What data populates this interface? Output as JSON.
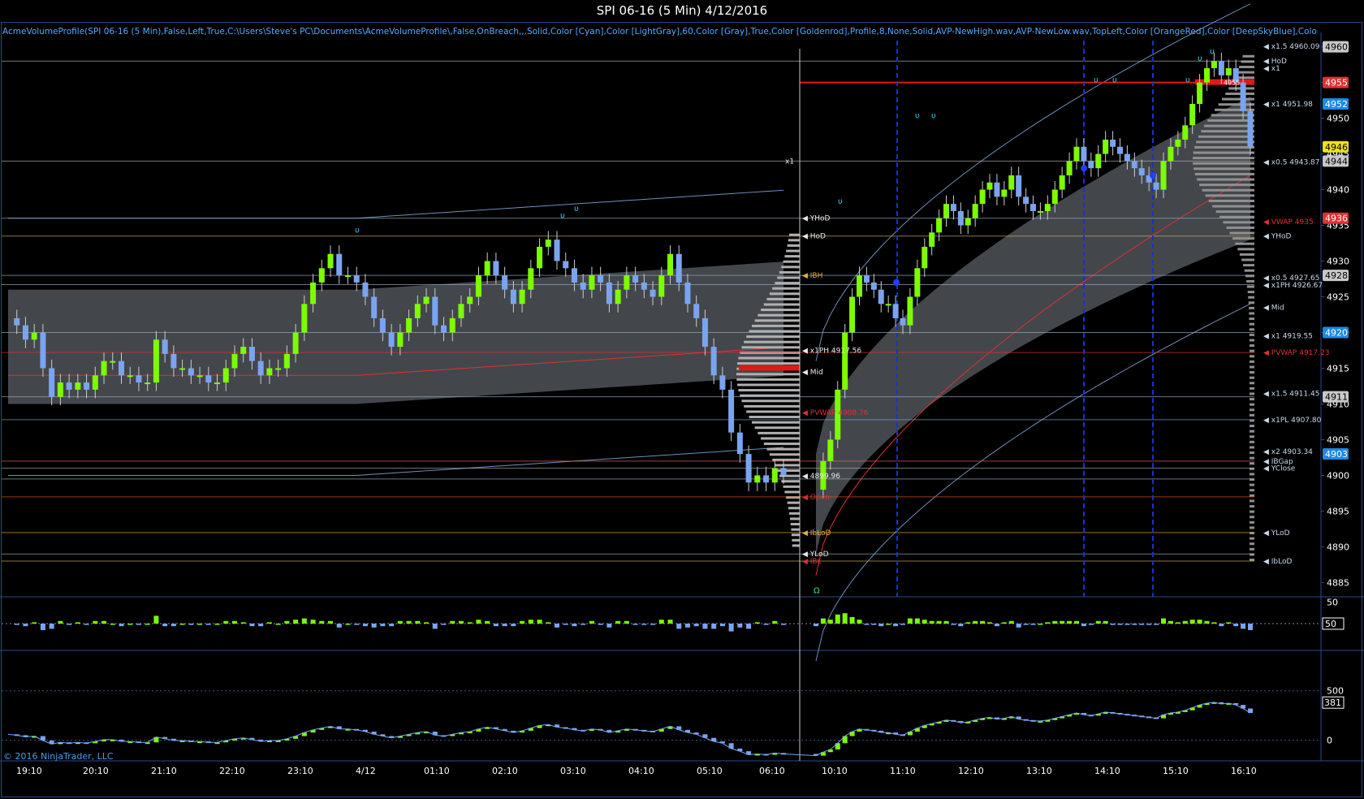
{
  "window": {
    "title": "SPI 06-16 (5 Min)  4/12/2016",
    "indicator_string": "AcmeVolumeProfile(SPI 06-16 (5 Min),False,Left,True,C:\\Users\\Steve's PC\\Documents\\AcmeVolumeProfile\\,False,OnBreach,,,Solid,Color [Cyan],Color [LightGray],60,Color [Gray],True,Color [Goldenrod],Profile,8,None,Solid,AVP-NewHigh.wav,AVP-NewLow.wav,TopLeft,Color [OrangeRed],Color [DeepSkyBlue],Color [Slat",
    "copyright": "© 2016 NinjaTrader, LLC"
  },
  "colors": {
    "up_bar": "#7cfc00",
    "down_bar": "#7ba4f0",
    "band": "#5a5f66",
    "vwap": "#e03030",
    "grid_line": "#9fb4c8",
    "axis_text": "#ffffff",
    "accent_blue": "#1e88e5"
  },
  "chart_data": [
    {
      "type": "candlestick",
      "title": "SPI 06-16 (5 Min)  4/12/2016",
      "x_ticks": [
        "19:10",
        "20:10",
        "21:10",
        "22:10",
        "23:10",
        "4/12",
        "01:10",
        "02:10",
        "03:10",
        "04:10",
        "05:10",
        "06:10",
        "10:10",
        "11:10",
        "12:10",
        "13:10",
        "14:10",
        "15:10",
        "16:10"
      ],
      "ylim": [
        4883,
        4962
      ],
      "y_ticks": [
        4885,
        4890,
        4895,
        4900,
        4905,
        4910,
        4915,
        4920,
        4925,
        4930,
        4935,
        4940,
        4945,
        4950,
        4955,
        4960
      ],
      "price_tags": [
        {
          "label": "4960",
          "color": "#c8c8c8",
          "value": 4960
        },
        {
          "label": "4955",
          "color": "#e03030",
          "value": 4955
        },
        {
          "label": "4952",
          "color": "#1e88e5",
          "value": 4952
        },
        {
          "label": "4946",
          "color": "#f0e020",
          "value": 4946
        },
        {
          "label": "4944",
          "color": "#c8c8c8",
          "value": 4944
        },
        {
          "label": "4936",
          "color": "#e03030",
          "value": 4936
        },
        {
          "label": "4928",
          "color": "#c8c8c8",
          "value": 4928
        },
        {
          "label": "4920",
          "color": "#1e88e5",
          "value": 4920
        },
        {
          "label": "4911",
          "color": "#c8c8c8",
          "value": 4911
        },
        {
          "label": "4903",
          "color": "#1e88e5",
          "value": 4903
        }
      ],
      "level_labels": [
        {
          "text": "x1.5  4960.09",
          "value": 4960.09
        },
        {
          "text": "HoD",
          "value": 4958
        },
        {
          "text": "x1",
          "value": 4957
        },
        {
          "text": "x1  4951.98",
          "value": 4951.98
        },
        {
          "text": "x0.5  4943.87",
          "value": 4943.87
        },
        {
          "text": "VWAP  4935",
          "value": 4935.5
        },
        {
          "text": "YHoD",
          "value": 4933.5
        },
        {
          "text": "x0.5  4927.65",
          "value": 4927.65
        },
        {
          "text": "x1PH 4926.67",
          "value": 4926.67
        },
        {
          "text": "Mid",
          "value": 4923.5
        },
        {
          "text": "x1  4919.55",
          "value": 4919.55
        },
        {
          "text": "PVWAP 4917.23",
          "value": 4917.23
        },
        {
          "text": "x1.5  4911.45",
          "value": 4911.45
        },
        {
          "text": "x1PL 4907.80",
          "value": 4907.8
        },
        {
          "text": "x2  4903.34",
          "value": 4903.34
        },
        {
          "text": "IBGap",
          "value": 4902.0
        },
        {
          "text": "YClose",
          "value": 4901.0
        },
        {
          "text": "YLoD",
          "value": 4892.0
        },
        {
          "text": "IbLoD",
          "value": 4888.0
        }
      ],
      "left_session_labels": [
        {
          "text": "YHoD",
          "value": 4936
        },
        {
          "text": "HoD",
          "value": 4933.5
        },
        {
          "text": "IBH",
          "value": 4928
        },
        {
          "text": "x1PH 4917.56",
          "value": 4917.5
        },
        {
          "text": "Mid",
          "value": 4914.5
        },
        {
          "text": "PVWAP 4908.76",
          "value": 4908.8
        },
        {
          "text": "4899.96",
          "value": 4899.96
        },
        {
          "text": "Open",
          "value": 4897
        },
        {
          "text": "IbLoD",
          "value": 4892
        },
        {
          "text": "YLoD",
          "value": 4889
        },
        {
          "text": "IBL",
          "value": 4888
        }
      ],
      "session_label": "x1",
      "tag_4955_small": "4955",
      "series": [
        {
          "name": "Overnight",
          "values": [
            4922,
            4921,
            4919,
            4920,
            4915,
            4911,
            4913,
            4912,
            4913,
            4912,
            4914,
            4916,
            4916,
            4914,
            4914,
            4913,
            4913,
            4919,
            4917,
            4915,
            4915,
            4914,
            4914,
            4913,
            4913,
            4915,
            4917,
            4918,
            4916,
            4914,
            4915,
            4915,
            4917,
            4920,
            4924,
            4927,
            4929,
            4931,
            4928,
            4928,
            4927,
            4925,
            4922,
            4920,
            4918,
            4920,
            4922,
            4924,
            4925,
            4921,
            4920,
            4922,
            4924,
            4925,
            4928,
            4930,
            4928,
            4926,
            4924,
            4926,
            4929,
            4932,
            4933,
            4930,
            4929,
            4927,
            4926,
            4928,
            4927,
            4924,
            4926,
            4928,
            4927,
            4926,
            4925,
            4928,
            4931,
            4927,
            4924,
            4922,
            4918,
            4914,
            4912,
            4906,
            4903,
            4899,
            4900,
            4899,
            4901,
            4900
          ]
        },
        {
          "name": "Day",
          "values": [
            4898,
            4902,
            4905,
            4912,
            4920,
            4925,
            4928,
            4927,
            4926,
            4924,
            4924,
            4922,
            4921,
            4925,
            4929,
            4932,
            4934,
            4936,
            4938,
            4937,
            4935,
            4936,
            4938,
            4940,
            4941,
            4939,
            4940,
            4942,
            4939,
            4938,
            4937,
            4937,
            4938,
            4940,
            4942,
            4944,
            4946,
            4944,
            4943,
            4945,
            4947,
            4946,
            4945,
            4944,
            4943,
            4942,
            4941,
            4940,
            4944,
            4946,
            4947,
            4949,
            4952,
            4955,
            4957,
            4958,
            4956,
            4957,
            4955,
            4951,
            4946
          ]
        }
      ]
    },
    {
      "type": "bar",
      "title": "",
      "ylim": [
        -60,
        60
      ],
      "y_ticks": [
        50
      ],
      "tag": "50"
    },
    {
      "type": "line",
      "title": "",
      "ylim": [
        -200,
        900
      ],
      "y_ticks": [
        0,
        500
      ],
      "tag": "381",
      "last_value": 381
    }
  ]
}
